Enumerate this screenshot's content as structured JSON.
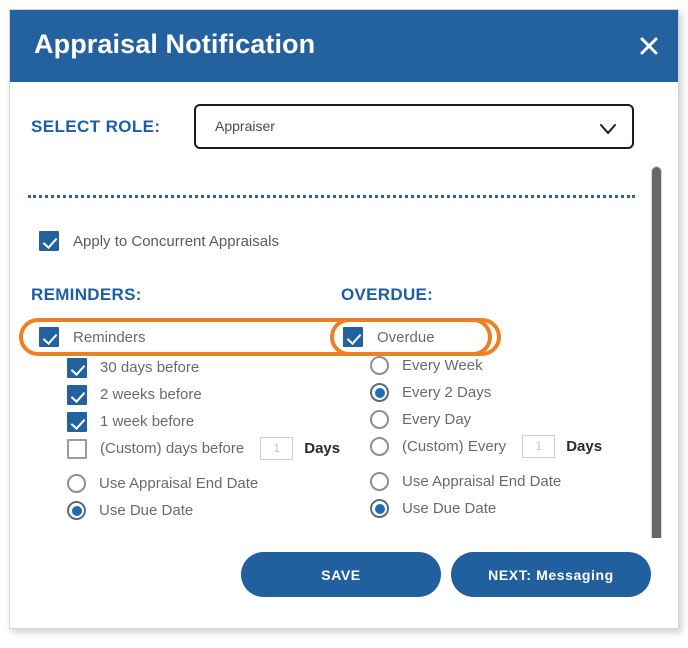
{
  "dialog": {
    "title": "Appraisal Notification",
    "close_icon": "close-icon"
  },
  "role": {
    "label": "SELECT ROLE:",
    "selected": "Appraiser",
    "chevron_icon": "chevron-down-icon"
  },
  "apply_concurrent": {
    "label": "Apply to Concurrent Appraisals",
    "checked": true
  },
  "reminders": {
    "heading": "REMINDERS:",
    "toggle_label": "Reminders",
    "toggle_checked": true,
    "highlighted": true,
    "options": [
      {
        "label": "30 days before",
        "type": "checkbox",
        "checked": true
      },
      {
        "label": "2 weeks before",
        "type": "checkbox",
        "checked": true
      },
      {
        "label": "1 week before",
        "type": "checkbox",
        "checked": true
      },
      {
        "label": "(Custom) days before",
        "type": "checkbox",
        "checked": false,
        "input_value": "1",
        "input_suffix": "Days"
      },
      {
        "label": "Use Appraisal End Date",
        "type": "radio",
        "checked": false
      },
      {
        "label": "Use Due Date",
        "type": "radio",
        "checked": true
      }
    ]
  },
  "overdue": {
    "heading": "OVERDUE:",
    "toggle_label": "Overdue",
    "toggle_checked": true,
    "highlighted": true,
    "options": [
      {
        "label": "Every Week",
        "type": "radio",
        "checked": false
      },
      {
        "label": "Every 2 Days",
        "type": "radio",
        "checked": true
      },
      {
        "label": "Every Day",
        "type": "radio",
        "checked": false
      },
      {
        "label": "(Custom) Every",
        "type": "radio",
        "checked": false,
        "input_value": "1",
        "input_suffix": "Days"
      },
      {
        "label": "Use Appraisal End Date",
        "type": "radio",
        "checked": false
      },
      {
        "label": "Use Due Date",
        "type": "radio",
        "checked": true
      }
    ]
  },
  "footer": {
    "save_label": "SAVE",
    "next_label": "NEXT: Messaging"
  },
  "colors": {
    "header_blue": "#23619f",
    "accent_blue": "#1d5fa4",
    "highlight_orange": "#ef7f22",
    "button_blue": "#215f9f",
    "text_gray": "#6a6a6a"
  }
}
